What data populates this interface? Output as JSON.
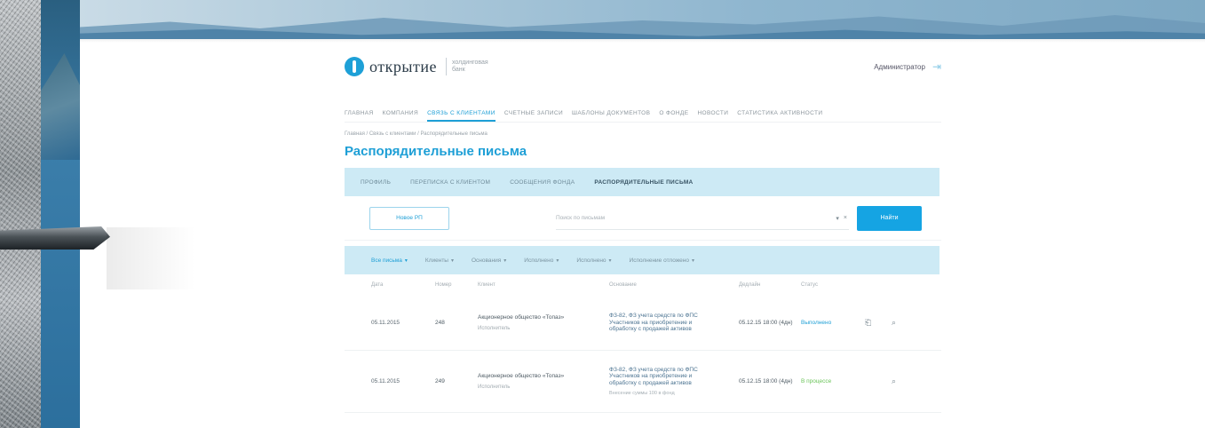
{
  "header": {
    "logo_text": "открытие",
    "logo_subtitle": "холдинговая банк",
    "user_name": "Администратор",
    "logout_icon": "logout-icon"
  },
  "topnav": [
    {
      "label": "Главная"
    },
    {
      "label": "Компания"
    },
    {
      "label": "Связь с клиентами",
      "active": true
    },
    {
      "label": "Счетные записи"
    },
    {
      "label": "Шаблоны документов"
    },
    {
      "label": "О фонде"
    },
    {
      "label": "Новости"
    },
    {
      "label": "Статистика активности"
    }
  ],
  "breadcrumb": "Главная / Связь с клиентами / Распорядительные письма",
  "page_title": "Распорядительные письма",
  "subtabs": [
    {
      "label": "Профиль"
    },
    {
      "label": "Переписка с клиентом"
    },
    {
      "label": "Сообщения фонда"
    },
    {
      "label": "Распорядительные письма",
      "active": true
    }
  ],
  "toolbar": {
    "new_button": "Новое РП",
    "search_placeholder": "Поиск по письмам",
    "search_dropdown": "▾",
    "search_clear": "×",
    "find_button": "Найти"
  },
  "filters": [
    {
      "label": "Все письма",
      "chev": "▾",
      "active": true
    },
    {
      "label": "Клиенты",
      "chev": "▾"
    },
    {
      "label": "Основания",
      "chev": "▾"
    },
    {
      "label": "Исполнено",
      "chev": "▾"
    },
    {
      "label": "Исполнено",
      "chev": "▾"
    },
    {
      "label": "Исполнение отложено",
      "chev": "▾"
    }
  ],
  "table": {
    "headers": {
      "date": "Дата",
      "number": "Номер",
      "client": "Клиент",
      "reason": "Основание",
      "deadline": "Дедлайн",
      "status": "Статус"
    },
    "rows": [
      {
        "date": "05.11.2015",
        "number": "248",
        "client": "Акционерное общество «Топаз»",
        "client_sub": "Исполнитель",
        "reason": "ФЗ-82, ФЗ учета средств по ФПС Участников на приобретение и обработку с продажей активов",
        "reason_extra": "",
        "deadline": "05.12.15 18:00 (4дн)",
        "status": "Выполнено",
        "status_color": "#1e9fd6",
        "action1_icon": "document-icon",
        "action2_icon": "search-icon"
      },
      {
        "date": "05.11.2015",
        "number": "249",
        "client": "Акционерное общество «Топаз»",
        "client_sub": "Исполнитель",
        "reason": "ФЗ-82, ФЗ учета средств по ФПС Участников на приобретение и обработку с продажей активов",
        "reason_extra": "Внесение суммы 100 в фонд",
        "deadline": "05.12.15 18:00 (4дн)",
        "status": "В процессе",
        "status_color": "#6bc45a",
        "action1_icon": "",
        "action2_icon": "search-icon"
      }
    ]
  }
}
